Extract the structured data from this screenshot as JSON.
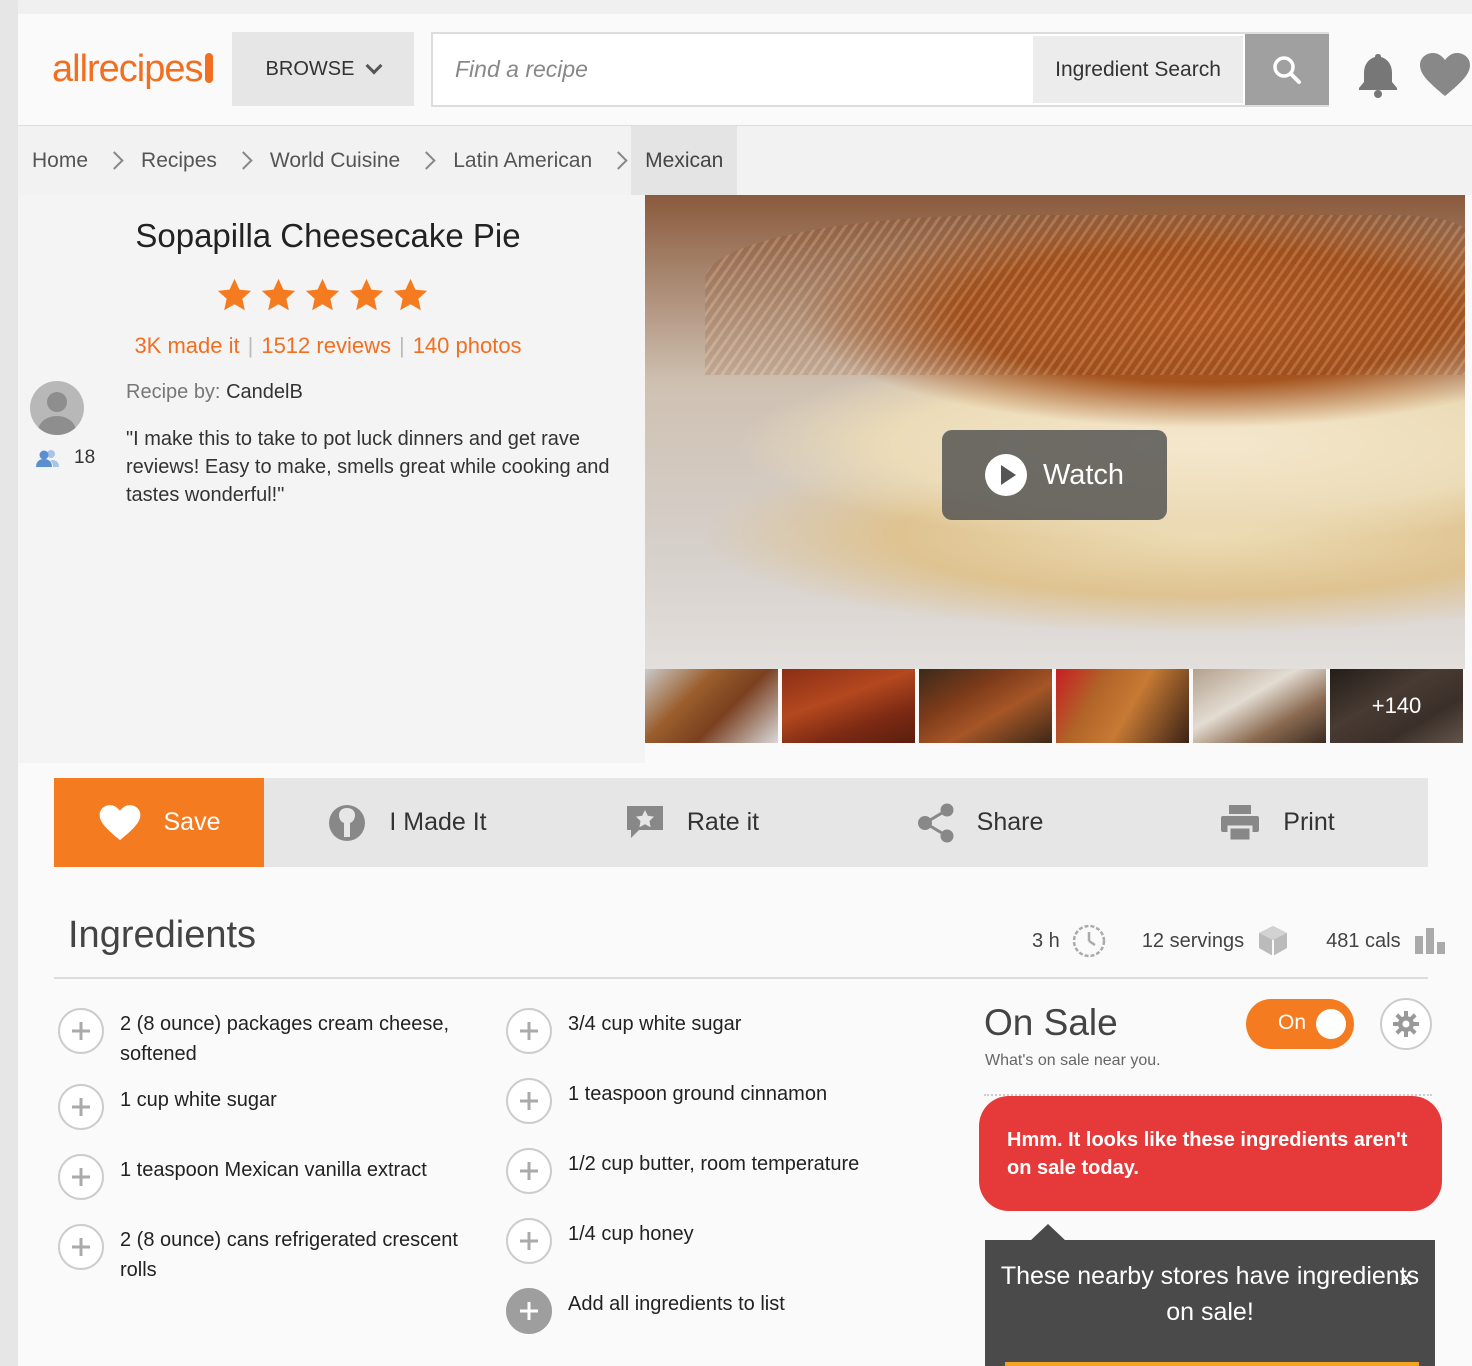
{
  "header": {
    "logo": "allrecipes",
    "browse_label": "BROWSE",
    "search_placeholder": "Find a recipe",
    "ingredient_search_label": "Ingredient Search"
  },
  "breadcrumb": [
    "Home",
    "Recipes",
    "World Cuisine",
    "Latin American",
    "Mexican"
  ],
  "recipe": {
    "title": "Sopapilla Cheesecake Pie",
    "rating_stars": 5,
    "made_it": "3K made it",
    "reviews": "1512 reviews",
    "photos": "140 photos",
    "recipe_by_label": "Recipe by:",
    "author": "CandelB",
    "followers": "18",
    "description": "\"I make this to take to pot luck dinners and get rave reviews! Easy to make, smells great while cooking and tastes wonderful!\""
  },
  "media": {
    "watch_label": "Watch",
    "more_photos": "+140"
  },
  "actions": {
    "save": "Save",
    "made_it": "I Made It",
    "rate": "Rate it",
    "share": "Share",
    "print": "Print"
  },
  "ingredients": {
    "title": "Ingredients",
    "time": "3 h",
    "servings": "12 servings",
    "cals": "481 cals",
    "left": [
      "2 (8 ounce) packages cream cheese, softened",
      "1 cup white sugar",
      "1 teaspoon Mexican vanilla extract",
      "2 (8 ounce) cans refrigerated crescent rolls"
    ],
    "right": [
      "3/4 cup white sugar",
      "1 teaspoon ground cinnamon",
      "1/2 cup butter, room temperature",
      "1/4 cup honey"
    ],
    "add_all": "Add all ingredients to list"
  },
  "on_sale": {
    "title": "On Sale",
    "subtitle": "What's on sale near you.",
    "toggle_label": "On",
    "alert": "Hmm. It looks like these ingredients aren't on sale today.",
    "tooltip": "These nearby stores have ingredients on sale!",
    "close": "x"
  },
  "colors": {
    "brand_orange": "#f47b20",
    "alert_red": "#e63a3a"
  }
}
